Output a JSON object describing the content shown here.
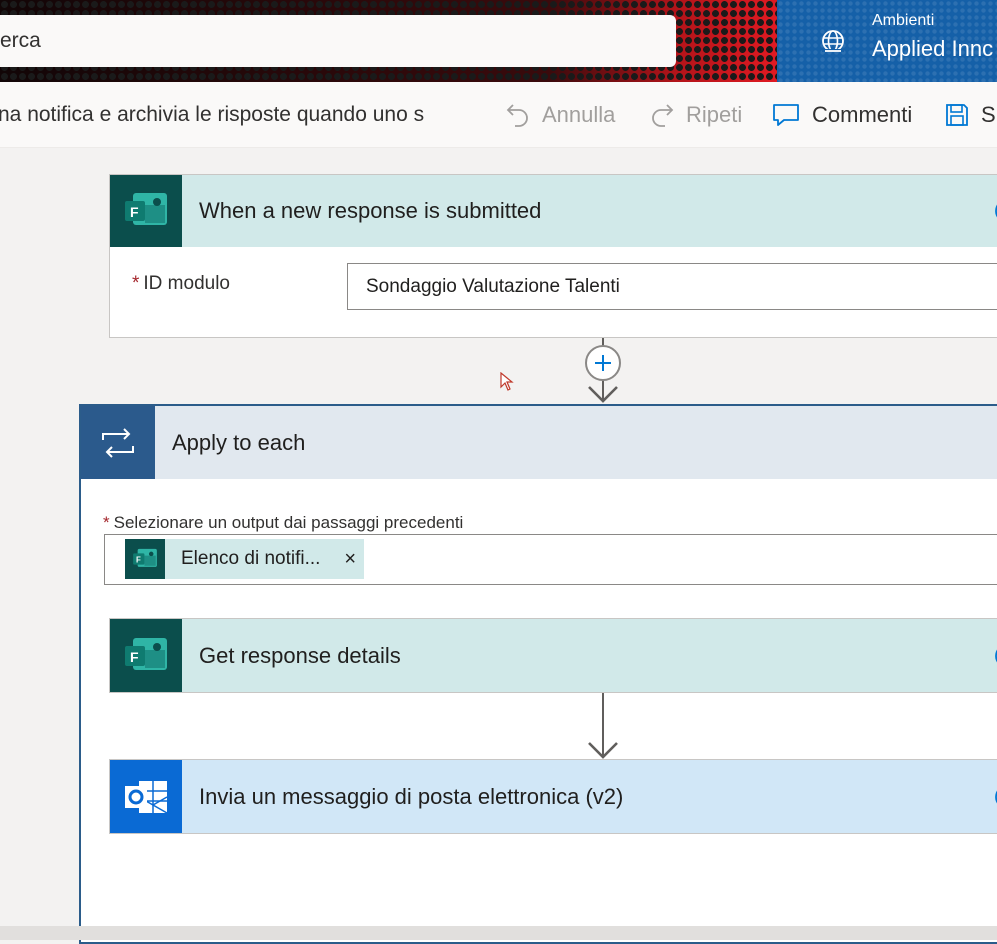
{
  "header": {
    "search_text": "erca",
    "environment_label": "Ambienti",
    "environment_name": "Applied Innc"
  },
  "command_bar": {
    "flow_title": "na notifica e archivia le risposte quando uno s",
    "undo_label": "Annulla",
    "redo_label": "Ripeti",
    "comments_label": "Commenti",
    "save_label": "S"
  },
  "trigger": {
    "title": "When a new response is submitted",
    "required_mark": "*",
    "field_label": "ID modulo",
    "field_value": "Sondaggio Valutazione Talenti"
  },
  "apply_to_each": {
    "title": "Apply to each",
    "required_mark": "*",
    "field_label": "Selezionare un output dai passaggi precedenti",
    "token_label": "Elenco di notifi...",
    "token_close": "×"
  },
  "get_response": {
    "title": "Get response details"
  },
  "send_email": {
    "title": "Invia un messaggio di posta elettronica (v2)"
  },
  "colors": {
    "forms_icon_bg": "#0b4e4c",
    "forms_header_bg": "#d1e9e9",
    "loop_icon_bg": "#1e4a7a",
    "loop_header_bg": "#e1e8ef",
    "outlook_icon_bg": "#0a6ad4",
    "outlook_header_bg": "#d1e7f7",
    "accent": "#0078d4"
  },
  "icons": [
    "globe-icon",
    "undo-icon",
    "redo-icon",
    "comment-icon",
    "save-icon",
    "forms-icon",
    "loop-icon",
    "outlook-icon",
    "help-icon",
    "plus-icon",
    "close-icon"
  ]
}
